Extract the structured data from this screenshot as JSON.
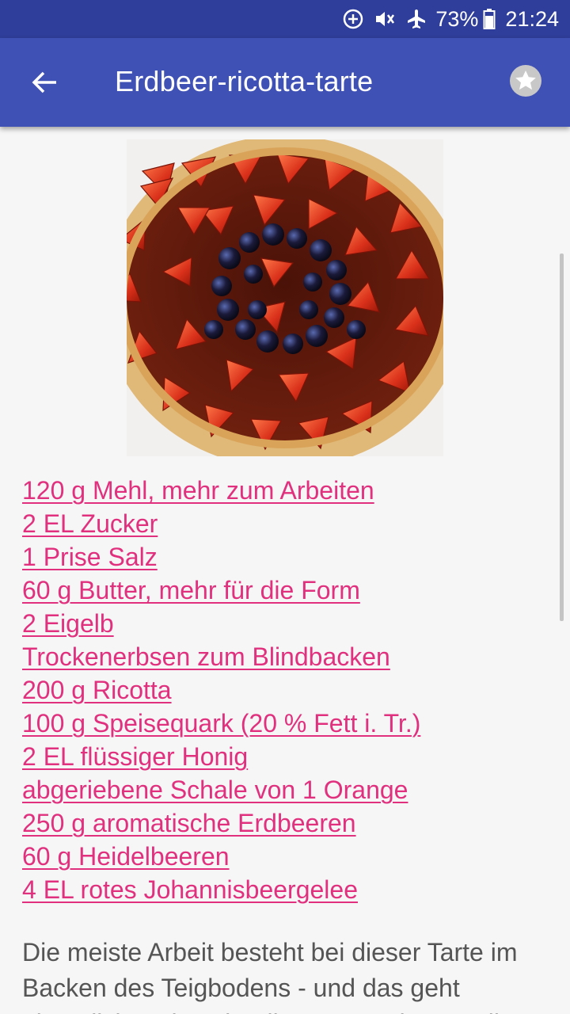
{
  "status_bar": {
    "battery": "73%",
    "time": "21:24",
    "icons": [
      "data-saver-icon",
      "vibrate-icon",
      "airplane-mode-icon",
      "battery-icon"
    ]
  },
  "app_bar": {
    "title": "Erdbeer-ricotta-tarte",
    "back_icon": "arrow-back-icon",
    "favorite_icon": "star-icon"
  },
  "recipe": {
    "image": "strawberry-blueberry-tart-photo",
    "ingredients": [
      "120 g Mehl, mehr zum Arbeiten",
      "2 EL Zucker",
      "1 Prise Salz",
      "60 g Butter, mehr für die Form",
      "2 Eigelb",
      "Trockenerbsen zum Blindbacken",
      "200 g Ricotta",
      "100 g Speisequark (20 % Fett i. Tr.)",
      "2 EL flüssiger Honig",
      "abgeriebene Schale von 1 Orange",
      "250 g aromatische Erdbeeren",
      "60 g Heidelbeeren",
      "4 EL rotes Johannisbeergelee"
    ],
    "description": "Die meiste Arbeit besteht bei dieser Tarte im Backen des Teigbodens - und das geht eigentlich recht schnell. Zum Festigen stellen"
  },
  "colors": {
    "status_bar": "#2f3e9a",
    "app_bar": "#3f51b5",
    "link": "#e0307e",
    "text": "#555555",
    "background": "#f6f6f6"
  }
}
